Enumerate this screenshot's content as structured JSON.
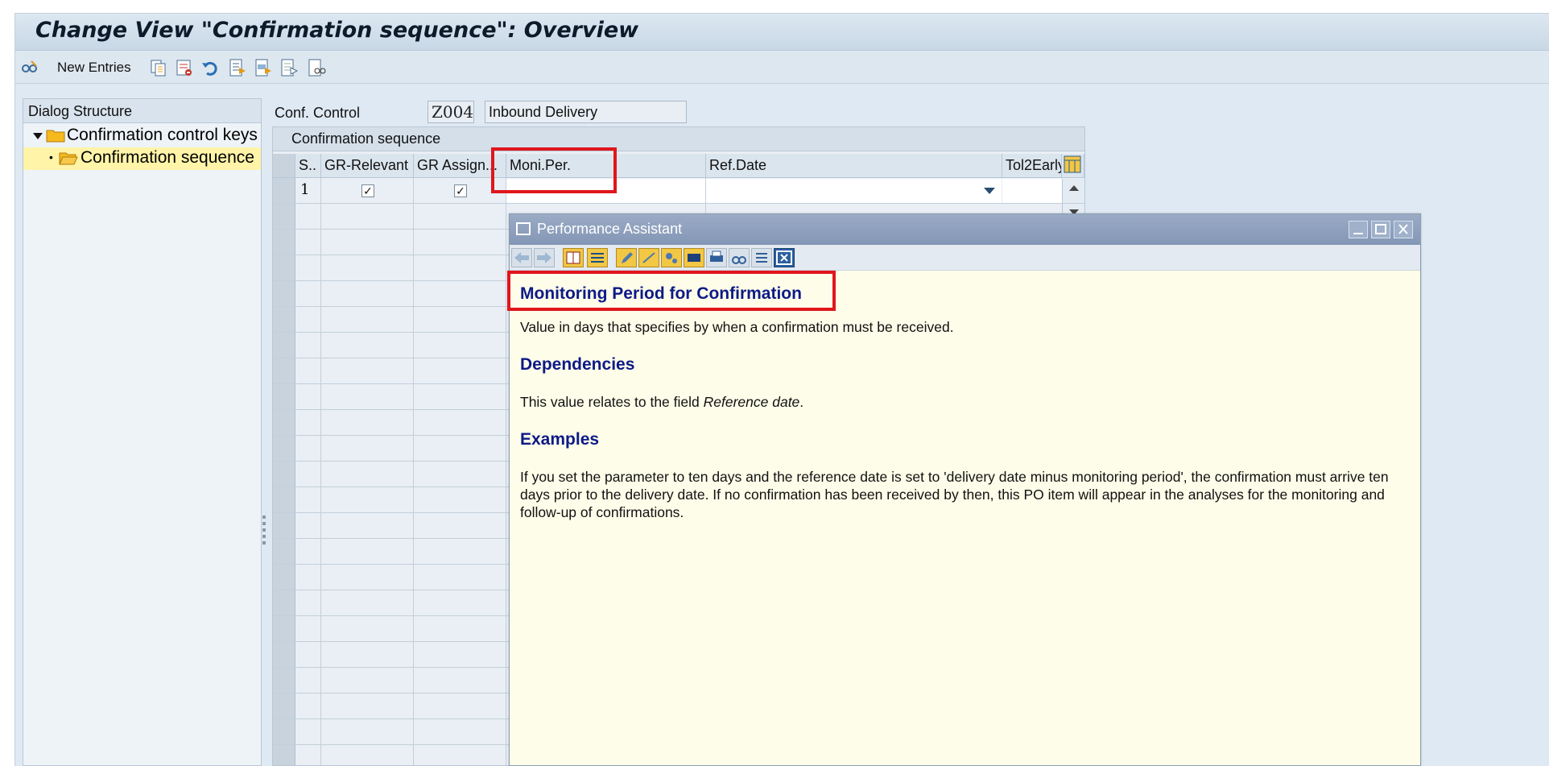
{
  "window": {
    "title": "Change View \"Confirmation sequence\": Overview"
  },
  "toolbar": {
    "new_entries_label": "New Entries",
    "icons": [
      "display-change-icon",
      "copy-icon",
      "delete-icon",
      "undo-icon",
      "select-all-icon",
      "select-block-icon",
      "deselect-all-icon",
      "where-used-icon"
    ]
  },
  "dialog_structure": {
    "heading": "Dialog Structure",
    "items": [
      {
        "label": "Confirmation control keys",
        "expanded": true
      },
      {
        "label": "Confirmation sequence",
        "selected": true
      }
    ]
  },
  "header_fields": {
    "conf_control_label": "Conf. Control",
    "conf_control_value": "Z004",
    "conf_control_desc": "Inbound Delivery"
  },
  "table": {
    "title": "Confirmation sequence",
    "columns": [
      "S..",
      "GR-Relevant",
      "GR Assign...",
      "Moni.Per.",
      "Ref.Date",
      "Tol2Early"
    ],
    "rows": [
      {
        "seq": "1",
        "gr_relevant": true,
        "gr_assign": true,
        "moni_per": "",
        "ref_date": "",
        "tol2early": ""
      }
    ]
  },
  "performance_assistant": {
    "title": "Performance Assistant",
    "heading": "Monitoring Period for Confirmation",
    "intro": "Value in days that specifies by when a confirmation must be received.",
    "dependencies_heading": "Dependencies",
    "dependencies_text_prefix": "This value relates to the field ",
    "dependencies_text_field": "Reference date",
    "dependencies_text_suffix": ".",
    "examples_heading": "Examples",
    "examples_text": "If you set the parameter to ten days and the reference date is set to 'delivery date minus monitoring period', the confirmation must arrive ten days prior to the delivery date. If no confirmation has been received by then, this PO item will appear in the analyses for the monitoring and follow-up of confirmations."
  },
  "colors": {
    "highlight_red": "#e0161c",
    "heading_blue": "#0d1a87",
    "help_background": "#fefde9",
    "selected_tree_row": "#fff4a8"
  }
}
